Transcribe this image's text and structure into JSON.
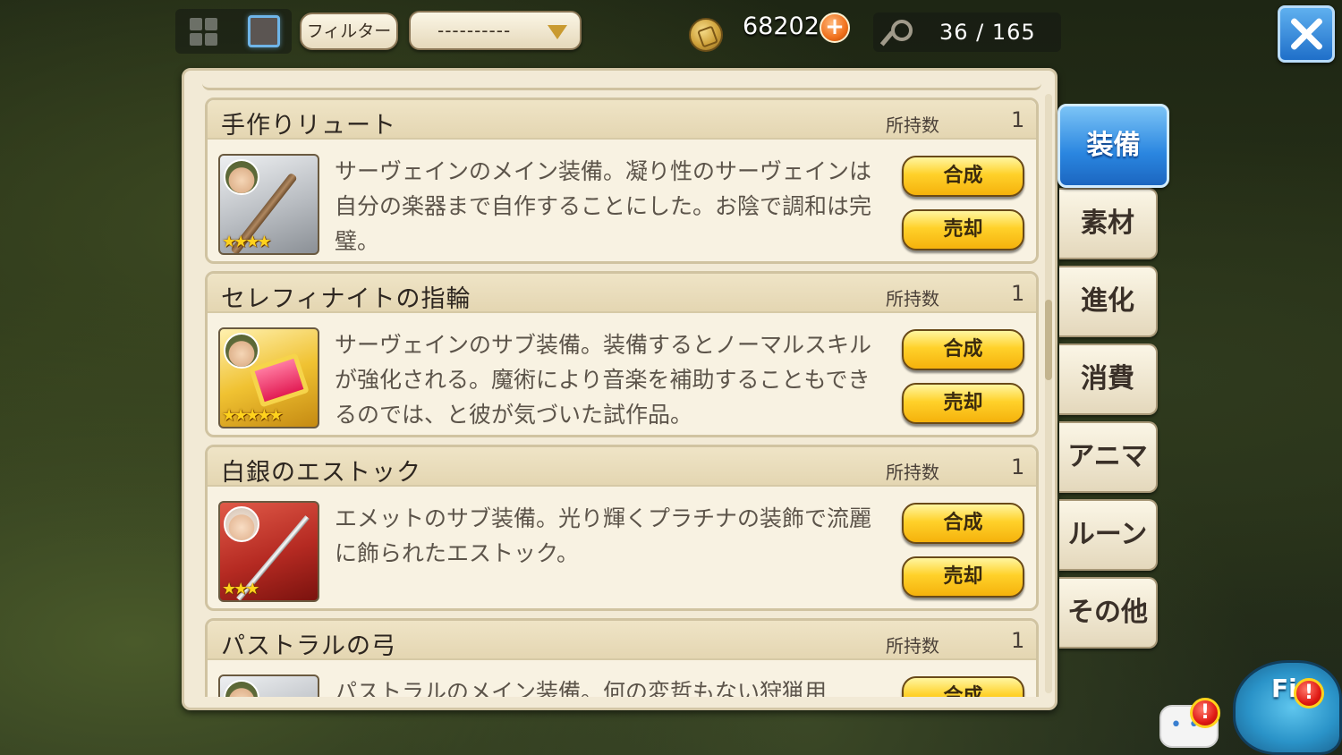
{
  "toolbar": {
    "filter_label": "フィルター",
    "select_value": "----------",
    "currency_amount": "68202",
    "plus_symbol": "+",
    "capacity": "36 / 165"
  },
  "items": [
    {
      "name": "手作りリュート",
      "owned_label": "所持数",
      "owned_count": "1",
      "stars": "★★★★",
      "rarity": 4,
      "icon": "lute-icon",
      "desc": "サーヴェインのメイン装備。凝り性のサーヴェインは自分の楽器まで自作することにした。お陰で調和は完璧。",
      "compose_label": "合成",
      "sell_label": "売却"
    },
    {
      "name": "セレフィナイトの指輪",
      "owned_label": "所持数",
      "owned_count": "1",
      "stars": "★★★★★",
      "rarity": 5,
      "icon": "ring-icon",
      "desc": "サーヴェインのサブ装備。装備するとノーマルスキルが強化される。魔術により音楽を補助することもできるのでは、と彼が気づいた試作品。",
      "compose_label": "合成",
      "sell_label": "売却"
    },
    {
      "name": "白銀のエストック",
      "owned_label": "所持数",
      "owned_count": "1",
      "stars": "★★★",
      "rarity": 3,
      "icon": "estoc-icon",
      "desc": "エメットのサブ装備。光り輝くプラチナの装飾で流麗に飾られたエストック。",
      "compose_label": "合成",
      "sell_label": "売却"
    },
    {
      "name": "パストラルの弓",
      "owned_label": "所持数",
      "owned_count": "1",
      "icon": "bow-icon",
      "desc": "パストラルのメイン装備。何の変哲もない狩猟用",
      "compose_label": "合成"
    }
  ],
  "tabs": [
    {
      "label": "装備",
      "active": true
    },
    {
      "label": "素材",
      "active": false
    },
    {
      "label": "進化",
      "active": false
    },
    {
      "label": "消費",
      "active": false
    },
    {
      "label": "アニマ",
      "active": false
    },
    {
      "label": "ルーン",
      "active": false
    },
    {
      "label": "その他",
      "active": false
    }
  ],
  "mascot": {
    "text": "Fi",
    "alert_symbol": "!"
  },
  "colors": {
    "panel_bg": "#f2ead6",
    "button_gold": "#ffd12a",
    "tab_active_blue": "#2a86e0",
    "close_blue": "#1f6fc9",
    "alert_red": "#e01a14"
  }
}
